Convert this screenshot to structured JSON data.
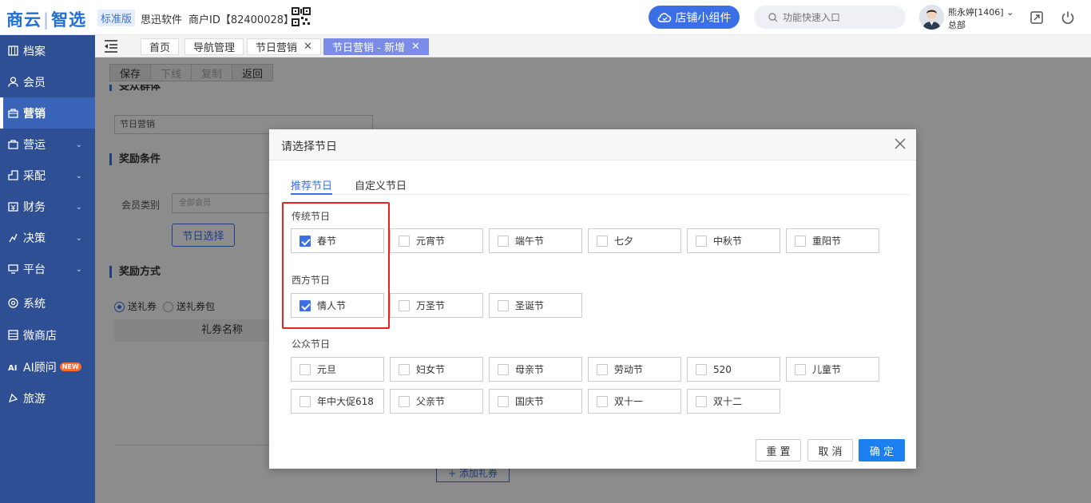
{
  "header": {
    "logo_left": "商云",
    "logo_sep": "|",
    "logo_right": "智选",
    "edition": "标准版",
    "company": "思迅软件",
    "merchant_id": "商户ID【82400028】",
    "widget_button": "店铺小组件",
    "search_placeholder": "功能快速入口",
    "user_name": "熊永婷[1406] ⌄",
    "user_dept": "总部"
  },
  "sidebar": {
    "items": [
      {
        "label": "档案",
        "icon": "archive-icon",
        "chevron": false
      },
      {
        "label": "会员",
        "icon": "member-icon",
        "chevron": false
      },
      {
        "label": "营销",
        "icon": "marketing-icon",
        "chevron": false,
        "active": true
      },
      {
        "label": "营运",
        "icon": "operation-icon",
        "chevron": true
      },
      {
        "label": "采配",
        "icon": "purchase-icon",
        "chevron": true
      },
      {
        "label": "财务",
        "icon": "finance-icon",
        "chevron": true
      },
      {
        "label": "决策",
        "icon": "decision-icon",
        "chevron": true
      },
      {
        "label": "平台",
        "icon": "platform-icon",
        "chevron": true
      },
      {
        "label": "系统",
        "icon": "system-icon",
        "chevron": false
      },
      {
        "label": "微商店",
        "icon": "shop-icon",
        "chevron": false
      },
      {
        "label": "AI顾问",
        "icon": "ai-icon",
        "chevron": false,
        "badge": "NEW"
      },
      {
        "label": "旅游",
        "icon": "travel-icon",
        "chevron": false
      }
    ]
  },
  "tabs": [
    {
      "label": "首页",
      "closable": false
    },
    {
      "label": "导航管理",
      "closable": false
    },
    {
      "label": "节日营销",
      "closable": true
    },
    {
      "label": "节日营销 - 新增",
      "closable": true,
      "active": true
    }
  ],
  "main": {
    "toolbar": {
      "save": "保存",
      "offline": "下线",
      "copy": "复制",
      "back": "返回"
    },
    "section_audience": "受众群体",
    "audience_value": "节日营销",
    "section_condition": "奖励条件",
    "member_type_label": "会员类别",
    "member_type_value": "全部会员",
    "holiday_select_button": "节日选择",
    "section_reward": "奖励方式",
    "reward_option_coupon": "送礼券",
    "reward_option_package": "送礼券包",
    "table_header_coupon_name": "礼券名称",
    "add_coupon_button": "+ 添加礼券"
  },
  "modal": {
    "title": "请选择节日",
    "tabs": [
      "推荐节日",
      "自定义节日"
    ],
    "groups": [
      {
        "label": "传统节日",
        "items": [
          {
            "name": "春节",
            "checked": true
          },
          {
            "name": "元宵节",
            "checked": false
          },
          {
            "name": "端午节",
            "checked": false
          },
          {
            "name": "七夕",
            "checked": false
          },
          {
            "name": "中秋节",
            "checked": false
          },
          {
            "name": "重阳节",
            "checked": false
          }
        ]
      },
      {
        "label": "西方节日",
        "items": [
          {
            "name": "情人节",
            "checked": true
          },
          {
            "name": "万圣节",
            "checked": false
          },
          {
            "name": "圣诞节",
            "checked": false
          }
        ]
      },
      {
        "label": "公众节日",
        "items": [
          {
            "name": "元旦",
            "checked": false
          },
          {
            "name": "妇女节",
            "checked": false
          },
          {
            "name": "母亲节",
            "checked": false
          },
          {
            "name": "劳动节",
            "checked": false
          },
          {
            "name": "520",
            "checked": false
          },
          {
            "name": "儿童节",
            "checked": false
          },
          {
            "name": "年中大促618",
            "checked": false
          },
          {
            "name": "父亲节",
            "checked": false
          },
          {
            "name": "国庆节",
            "checked": false
          },
          {
            "name": "双十一",
            "checked": false
          },
          {
            "name": "双十二",
            "checked": false
          }
        ]
      }
    ],
    "buttons": {
      "reset": "重 置",
      "cancel": "取 消",
      "confirm": "确 定"
    }
  },
  "colors": {
    "brand": "#3b6fe8",
    "sidebar": "#2f4f94",
    "highlight": "#e82222",
    "confirm": "#1b7ff0"
  }
}
